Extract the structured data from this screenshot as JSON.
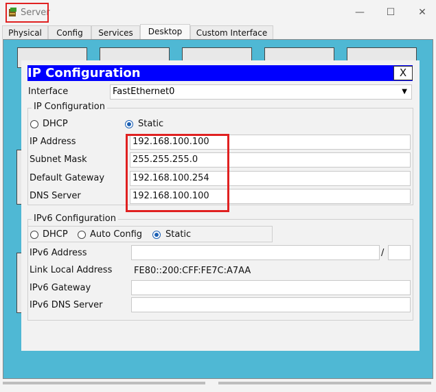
{
  "window": {
    "title": "Server",
    "minimize": "—",
    "maximize": "☐",
    "close": "✕"
  },
  "tabs": [
    "Physical",
    "Config",
    "Services",
    "Desktop",
    "Custom Interface"
  ],
  "dialog": {
    "title": "IP Configuration",
    "close_label": "X",
    "interface_label": "Interface",
    "interface_value": "FastEthernet0",
    "ipv4": {
      "group_title": "IP Configuration",
      "dhcp_label": "DHCP",
      "static_label": "Static",
      "mode": "Static",
      "ip_label": "IP Address",
      "ip_value": "192.168.100.100",
      "mask_label": "Subnet Mask",
      "mask_value": "255.255.255.0",
      "gateway_label": "Default Gateway",
      "gateway_value": "192.168.100.254",
      "dns_label": "DNS Server",
      "dns_value": "192.168.100.100"
    },
    "ipv6": {
      "group_title": "IPv6 Configuration",
      "dhcp_label": "DHCP",
      "auto_label": "Auto Config",
      "static_label": "Static",
      "mode": "Static",
      "address_label": "IPv6 Address",
      "address_value": "",
      "prefix_sep": "/",
      "prefix_value": "",
      "link_local_label": "Link Local Address",
      "link_local_value": "FE80::200:CFF:FE7C:A7AA",
      "gateway_label": "IPv6 Gateway",
      "gateway_value": "",
      "dns_label": "IPv6 DNS Server",
      "dns_value": ""
    }
  },
  "colors": {
    "dialog_header": "#0000ff",
    "desktop_bg": "#4fb8d4",
    "highlight": "#e02020"
  }
}
